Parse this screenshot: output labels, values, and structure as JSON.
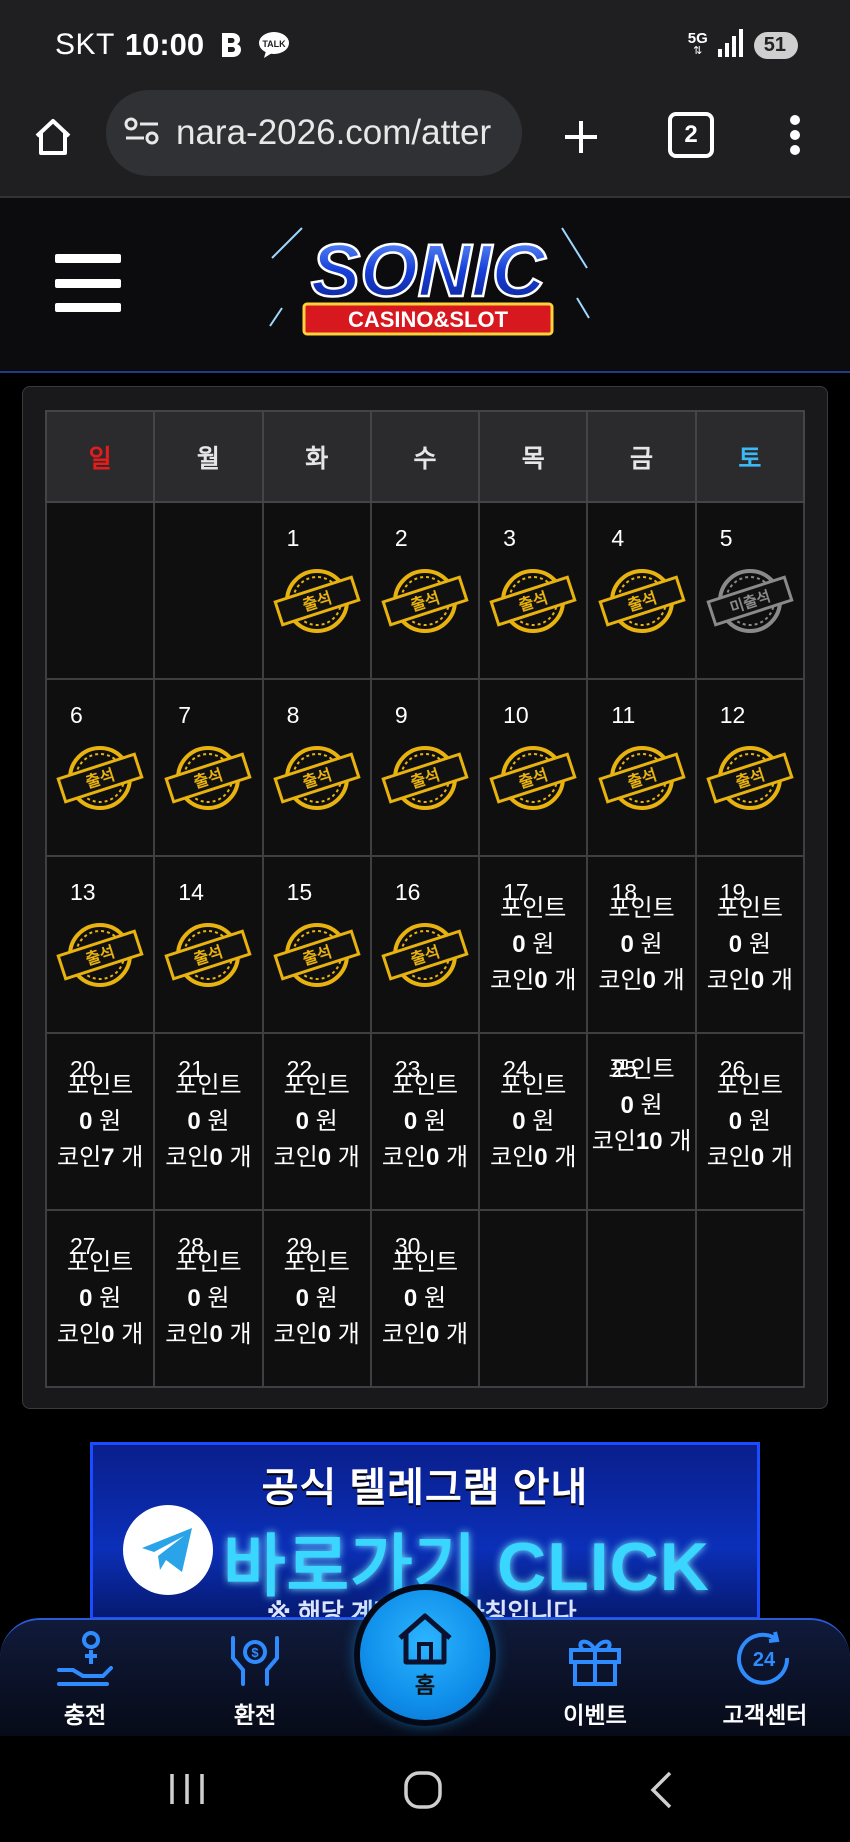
{
  "status_bar": {
    "carrier": "SKT",
    "time": "10:00",
    "network": "5G",
    "battery": "51"
  },
  "browser": {
    "url": "nara-2026.com/atter",
    "tab_count": "2"
  },
  "site": {
    "logo_title": "SONIC",
    "logo_subtitle": "CASINO&SLOT"
  },
  "calendar": {
    "weekdays": [
      {
        "label": "일",
        "color": "#e81b1b"
      },
      {
        "label": "월",
        "color": "#e6e6e6"
      },
      {
        "label": "화",
        "color": "#e6e6e6"
      },
      {
        "label": "수",
        "color": "#e6e6e6"
      },
      {
        "label": "목",
        "color": "#e6e6e6"
      },
      {
        "label": "금",
        "color": "#e6e6e6"
      },
      {
        "label": "토",
        "color": "#3db8f5"
      }
    ],
    "stamp_attended": "출석",
    "stamp_absent": "미출석",
    "point_label": "포인트",
    "won_unit": "원",
    "coin_label": "코인",
    "count_unit": "개",
    "weeks": [
      [
        null,
        null,
        {
          "day": "1",
          "status": "attended"
        },
        {
          "day": "2",
          "status": "attended"
        },
        {
          "day": "3",
          "status": "attended"
        },
        {
          "day": "4",
          "status": "attended"
        },
        {
          "day": "5",
          "status": "absent"
        }
      ],
      [
        {
          "day": "6",
          "status": "attended"
        },
        {
          "day": "7",
          "status": "attended"
        },
        {
          "day": "8",
          "status": "attended"
        },
        {
          "day": "9",
          "status": "attended"
        },
        {
          "day": "10",
          "status": "attended"
        },
        {
          "day": "11",
          "status": "attended"
        },
        {
          "day": "12",
          "status": "attended"
        }
      ],
      [
        {
          "day": "13",
          "status": "attended"
        },
        {
          "day": "14",
          "status": "attended"
        },
        {
          "day": "15",
          "status": "attended"
        },
        {
          "day": "16",
          "status": "attended"
        },
        {
          "day": "17",
          "status": "points",
          "points": "0",
          "coins": "0"
        },
        {
          "day": "18",
          "status": "points",
          "points": "0",
          "coins": "0"
        },
        {
          "day": "19",
          "status": "points",
          "points": "0",
          "coins": "0"
        }
      ],
      [
        {
          "day": "20",
          "status": "points",
          "points": "0",
          "coins": "7"
        },
        {
          "day": "21",
          "status": "points",
          "points": "0",
          "coins": "0"
        },
        {
          "day": "22",
          "status": "points",
          "points": "0",
          "coins": "0"
        },
        {
          "day": "23",
          "status": "points",
          "points": "0",
          "coins": "0"
        },
        {
          "day": "24",
          "status": "points",
          "points": "0",
          "coins": "0"
        },
        {
          "day": "25",
          "status": "points",
          "points": "0",
          "coins": "10"
        },
        {
          "day": "26",
          "status": "points",
          "points": "0",
          "coins": "0"
        }
      ],
      [
        {
          "day": "27",
          "status": "points",
          "points": "0",
          "coins": "0"
        },
        {
          "day": "28",
          "status": "points",
          "points": "0",
          "coins": "0"
        },
        {
          "day": "29",
          "status": "points",
          "points": "0",
          "coins": "0"
        },
        {
          "day": "30",
          "status": "points",
          "points": "0",
          "coins": "0"
        },
        null,
        null,
        null
      ]
    ]
  },
  "banner": {
    "title": "공식 텔레그램 안내",
    "cta": "바로가기 CLICK",
    "note": "※ 해당 계정 외 ... 사칭입니다."
  },
  "bottom_nav": {
    "deposit": "충전",
    "withdraw": "환전",
    "home": "홈",
    "event": "이벤트",
    "support": "고객센터"
  },
  "colors": {
    "accent": "#1aa0ff",
    "stamp_gold": "#e8b20f",
    "stamp_gray": "#8a8a8a"
  }
}
